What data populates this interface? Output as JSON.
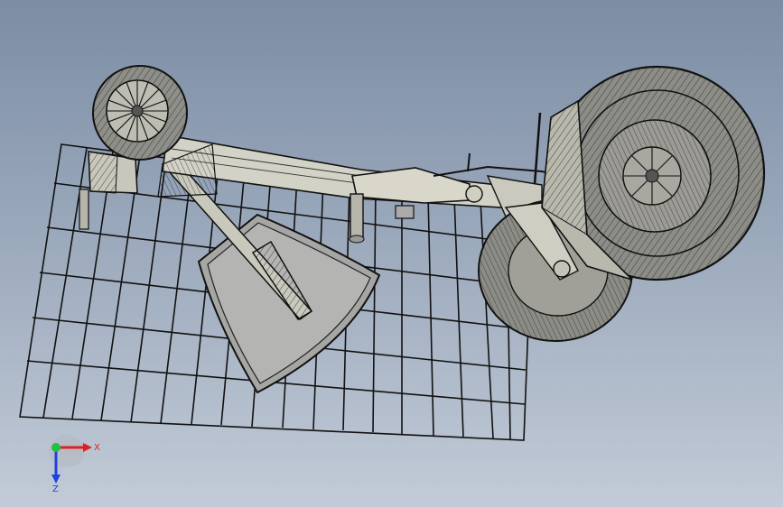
{
  "triad": {
    "x_label": "X",
    "z_label": "Z",
    "x_color": "#e02020",
    "z_color": "#2040e0",
    "origin_color": "#20c040"
  },
  "colors": {
    "edge": "#1a1a1a",
    "tire_fill": "#8d8d88",
    "frame_fill": "#d3d2c6",
    "background_top": "#7c8da4",
    "background_bottom": "#c2cbd7"
  },
  "icons": {
    "axis_triad": "xyz-triad-icon"
  }
}
